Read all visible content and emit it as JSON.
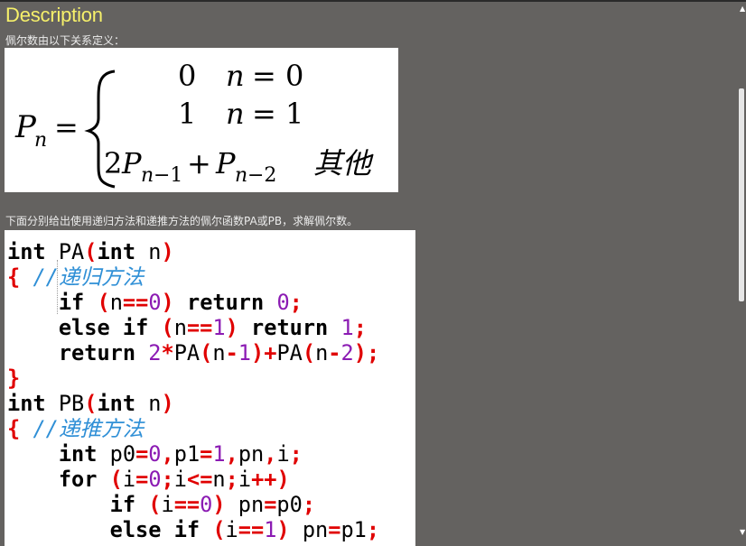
{
  "description": {
    "title": "Description",
    "intro": "佩尔数由以下关系定义：",
    "body": "下面分别给出使用递归方法和递推方法的佩尔函数PA或PB，求解佩尔数。"
  },
  "formula": {
    "lhs": "Pn =",
    "cases": [
      {
        "value": "0",
        "condition": "n = 0"
      },
      {
        "value": "1",
        "condition": "n = 1"
      },
      {
        "value": "2Pn−1 + Pn−2",
        "condition": "其他"
      }
    ]
  },
  "code": {
    "language": "C",
    "lines": [
      "int PA(int n)",
      "{ //递归方法",
      "    if (n==0) return 0;",
      "    else if (n==1) return 1;",
      "    return 2*PA(n-1)+PA(n-2);",
      "}",
      "int PB(int n)",
      "{ //递推方法",
      "    int p0=0,p1=1,pn,i;",
      "    for (i=0;i<=n;i++)",
      "        if (i==0) pn=p0;",
      "        else if (i==1) pn=p1;"
    ]
  },
  "colors": {
    "background": "#646260",
    "title": "#f6f06a",
    "keyword": "#000000",
    "operator": "#e00000",
    "number": "#8b1bb3",
    "comment": "#2f8fd6"
  }
}
